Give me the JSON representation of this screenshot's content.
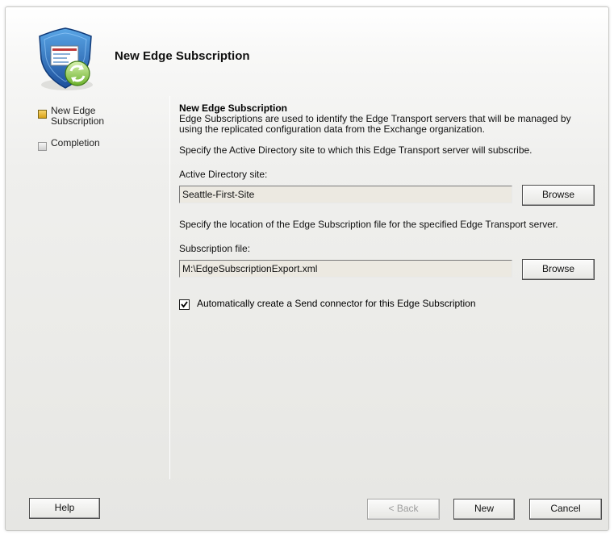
{
  "wizard": {
    "title": "New Edge Subscription",
    "icon": "shield-envelope-refresh-icon"
  },
  "steps": [
    {
      "label": "New Edge Subscription",
      "line1": "New Edge",
      "line2": "Subscription",
      "state": "active"
    },
    {
      "label": "Completion",
      "state": "inactive"
    }
  ],
  "content": {
    "section_title": "New Edge Subscription",
    "description_line1": "Edge Subscriptions are used to identify the Edge Transport servers that will be managed by",
    "description_line2": "using the replicated configuration data from the Exchange organization.",
    "site_instruction": "Specify the Active Directory site to which this Edge Transport server will subscribe.",
    "site_label": "Active Directory site:",
    "site_value": "Seattle-First-Site",
    "site_browse": "Browse",
    "file_instruction": "Specify the location of the Edge Subscription file for the specified Edge Transport server.",
    "file_label": "Subscription file:",
    "file_value": "M:\\EdgeSubscriptionExport.xml",
    "file_browse": "Browse",
    "checkbox_label": "Automatically create a Send connector for this Edge Subscription",
    "checkbox_checked": true
  },
  "footer": {
    "help": "Help",
    "back": "< Back",
    "new": "New",
    "cancel": "Cancel"
  },
  "colors": {
    "active_step": "#e0a820",
    "inactive_step": "#cfcfcf",
    "field_bg": "#ece9e1"
  }
}
